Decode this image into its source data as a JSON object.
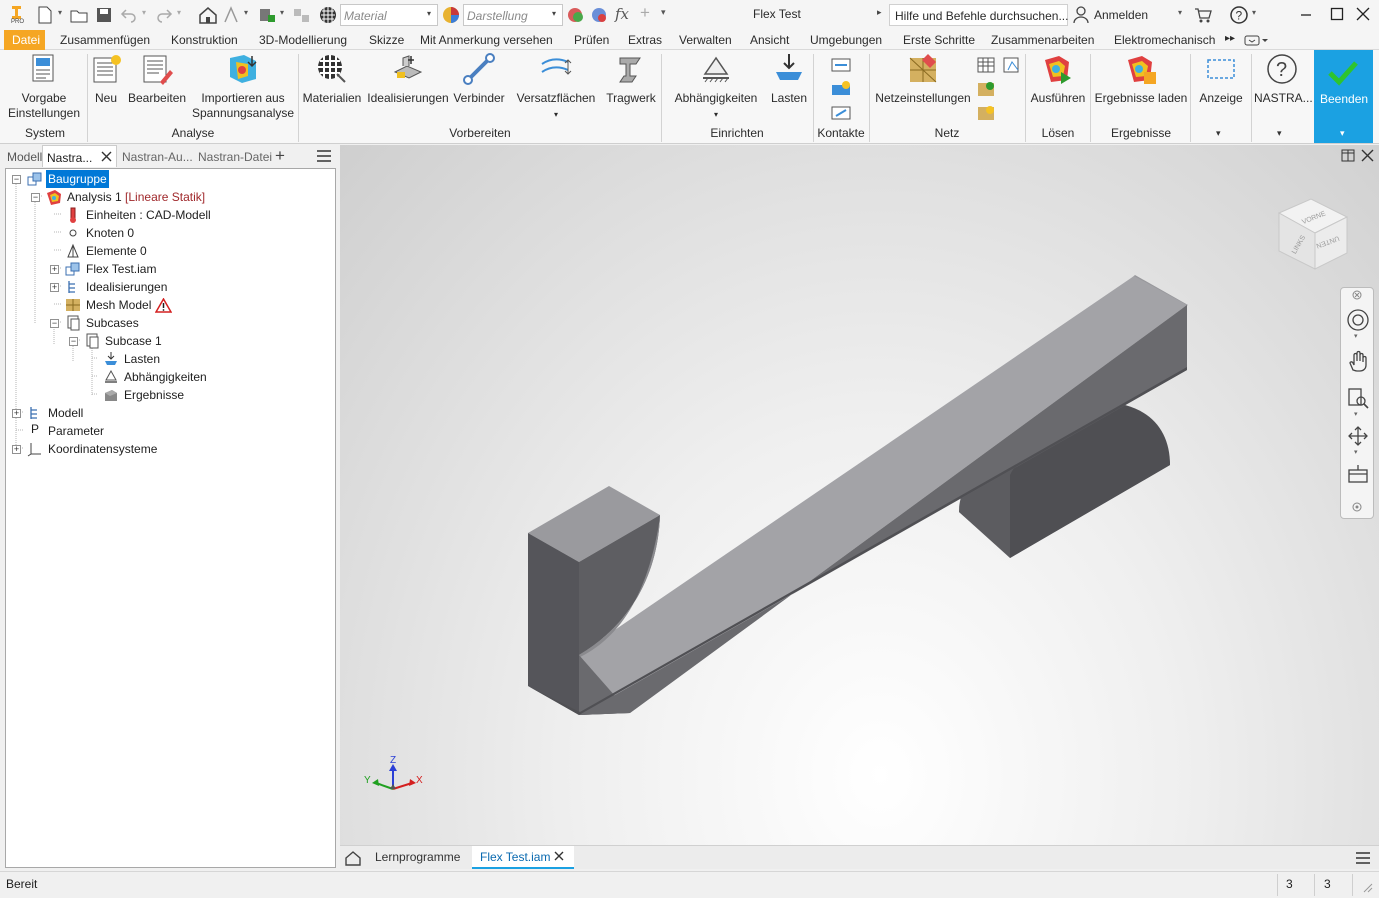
{
  "title": {
    "app_badge": "PRO",
    "document": "Flex Test",
    "material_placeholder": "Material",
    "appearance_placeholder": "Darstellung",
    "search": "Hilfe und Befehle durchsuchen...",
    "signin": "Anmelden",
    "fx": "fx"
  },
  "menu": [
    "Datei",
    "Zusammenfügen",
    "Konstruktion",
    "3D-Modellierung",
    "Skizze",
    "Mit Anmerkung versehen",
    "Prüfen",
    "Extras",
    "Verwalten",
    "Ansicht",
    "Umgebungen",
    "Erste Schritte",
    "Zusammenarbeiten",
    "Elektromechanisch"
  ],
  "ribbon": {
    "buttons": {
      "vorgabe1": "Vorgabe",
      "vorgabe2": "Einstellungen",
      "neu": "Neu",
      "bearbeiten": "Bearbeiten",
      "import1": "Importieren aus",
      "import2": "Spannungsanalyse",
      "materialien": "Materialien",
      "idealisierungen": "Idealisierungen",
      "verbinder": "Verbinder",
      "versatz": "Versatzflächen",
      "tragwerk": "Tragwerk",
      "abh": "Abhängigkeiten",
      "lasten": "Lasten",
      "netz": "Netzeinstellungen",
      "ausfuehren": "Ausführen",
      "ergebnisse": "Ergebnisse laden",
      "anzeige": "Anzeige",
      "nastran": "NASTRA...",
      "beenden": "Beenden"
    },
    "groups": [
      "System",
      "Analyse",
      "Vorbereiten",
      "Einrichten",
      "Kontakte",
      "Netz",
      "Lösen",
      "Ergebnisse"
    ]
  },
  "panel": {
    "tabs": [
      "Modell",
      "Nastra...",
      "Nastran-Au...",
      "Nastran-Datei"
    ],
    "tree": {
      "root": "Baugruppe",
      "analysis": "Analysis 1",
      "analysis_type": "[Lineare Statik]",
      "units": "Einheiten : CAD-Modell",
      "nodes": "Knoten 0",
      "elements": "Elemente 0",
      "flex": "Flex Test.iam",
      "ideal": "Idealisierungen",
      "mesh": "Mesh Model",
      "subcases": "Subcases",
      "subcase1": "Subcase 1",
      "loads": "Lasten",
      "constraints": "Abhängigkeiten",
      "results": "Ergebnisse",
      "model": "Modell",
      "params_icon": "P",
      "params": "Parameter",
      "coords": "Koordinatensysteme"
    }
  },
  "viewcube": {
    "front": "VORNE",
    "left": "LINKS",
    "bottom": "UNTEN"
  },
  "triad": {
    "x": "X",
    "y": "Y",
    "z": "Z"
  },
  "doctabs": {
    "learn": "Lernprogramme",
    "active": "Flex Test.iam"
  },
  "status": {
    "text": "Bereit",
    "count1": "3",
    "count2": "3"
  },
  "colors": {
    "accent_orange": "#f5a623",
    "beenden_green": "#1ba1e2",
    "selection_blue": "#0078d7"
  }
}
